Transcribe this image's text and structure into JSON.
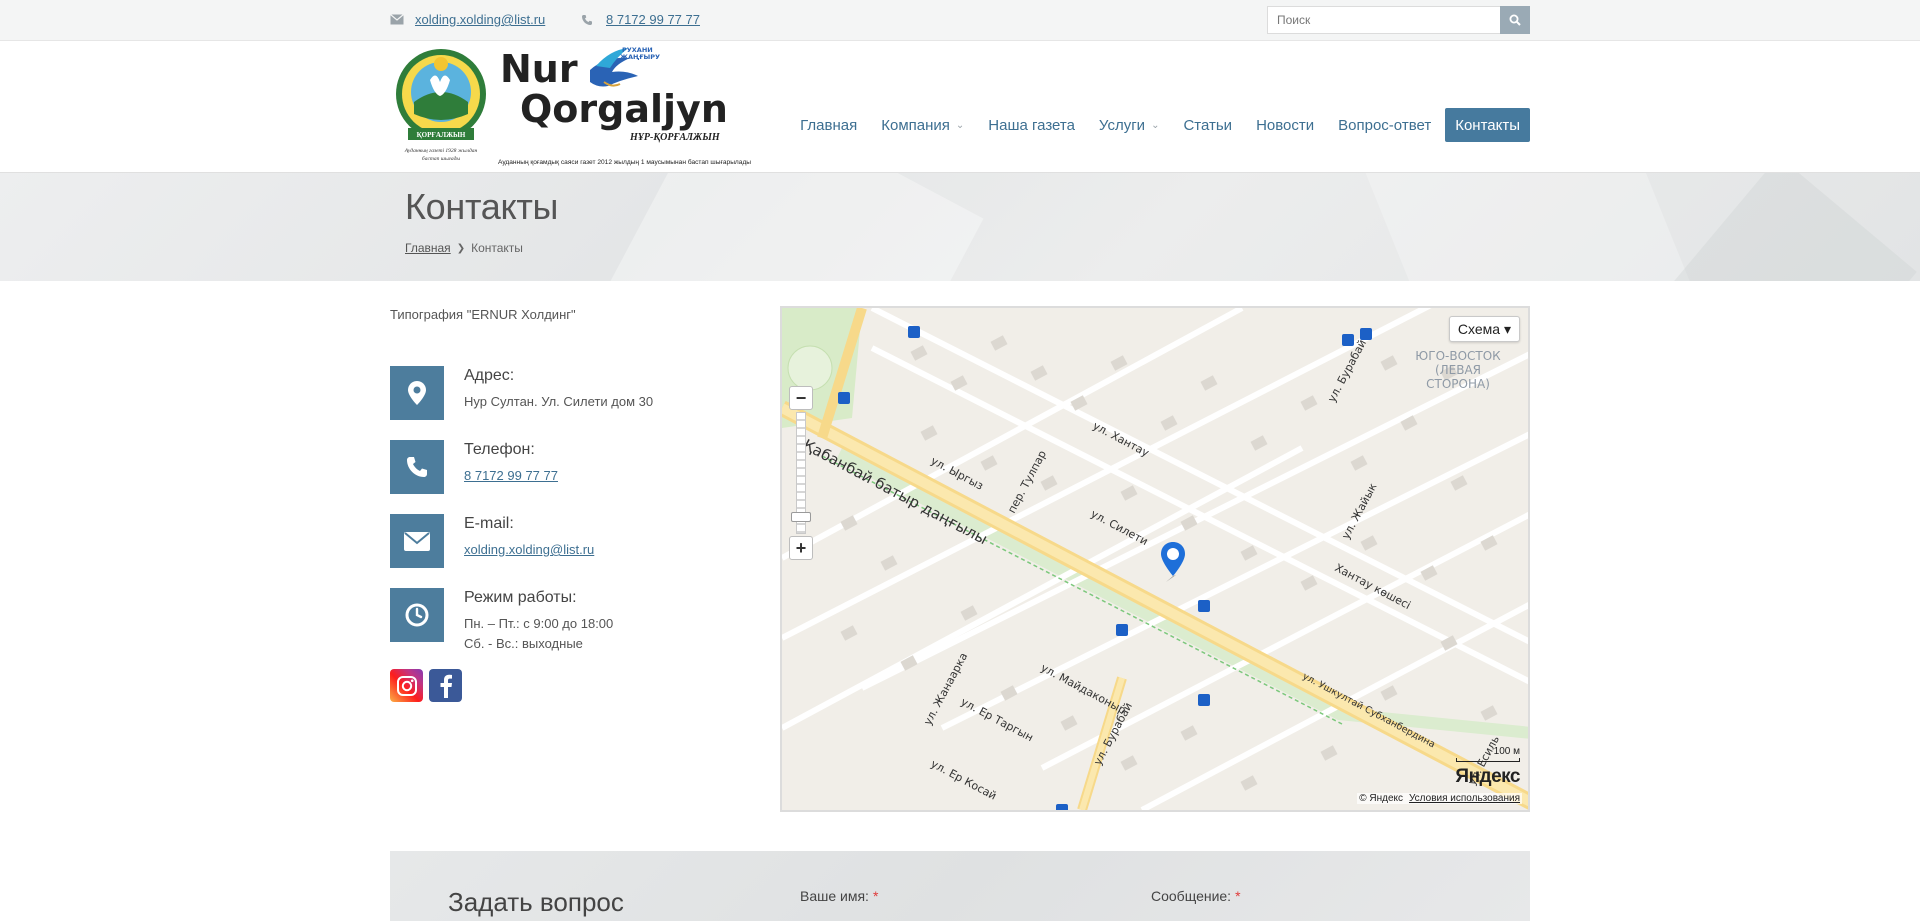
{
  "topbar": {
    "email": "xolding.xolding@list.ru",
    "phone": "8 7172 99 77 77",
    "search_placeholder": "Поиск"
  },
  "logo": {
    "text_line1": "Nur",
    "text_line2": "Qorgaljyn",
    "subtitle": "НҰР-ҚОРҒАЛЖЫН",
    "badge": "РУХАНИ ЖАҢҒЫРУ",
    "tagline": "Ауданның қоғамдық саяси газет 2012 жылдың 1 маусымынан бастап шығарылады"
  },
  "nav": {
    "items": [
      {
        "label": "Главная",
        "has_dropdown": false
      },
      {
        "label": "Компания",
        "has_dropdown": true
      },
      {
        "label": "Наша газета",
        "has_dropdown": false
      },
      {
        "label": "Услуги",
        "has_dropdown": true
      },
      {
        "label": "Статьи",
        "has_dropdown": false
      },
      {
        "label": "Новости",
        "has_dropdown": false
      },
      {
        "label": "Вопрос-ответ",
        "has_dropdown": false
      },
      {
        "label": "Контакты",
        "has_dropdown": false,
        "active": true
      }
    ]
  },
  "page": {
    "title": "Контакты",
    "breadcrumb": {
      "home": "Главная",
      "current": "Контакты"
    }
  },
  "contacts": {
    "company": "Типография \"ERNUR Холдинг\"",
    "address_label": "Адрес:",
    "address_value": "Нур Султан. Ул. Силети дом 30",
    "phone_label": "Телефон:",
    "phone_value": "8 7172 99 77 77",
    "email_label": "E-mail:",
    "email_value": "xolding.xolding@list.ru",
    "hours_label": "Режим работы:",
    "hours_weekdays": "Пн. – Пт.: с 9:00 до 18:00",
    "hours_weekend": "Сб. - Вс.: выходные"
  },
  "map": {
    "layer_button": "Схема ▾",
    "scale": "100 м",
    "brand": "Яндекс",
    "copyright": "© Яндекс",
    "terms": "Условия использования",
    "district": "ЮГО-ВОСТОК (ЛЕВАЯ СТОРОНА)",
    "streets": [
      "Қабанбай батыр даңғылы",
      "ул. Ыргыз",
      "пер. Тулпар",
      "ул. Силети",
      "ул. Хантау",
      "ул. Бурабай",
      "ул. Жайык",
      "Хантау көшесі",
      "ул. Майдаконыр",
      "ул. Жанаарка",
      "ул. Ер Таргын",
      "ул. Ер Косай",
      "ул. Ушкултай Субханбердина",
      "ул. Есиль"
    ]
  },
  "question_form": {
    "title": "Задать вопрос",
    "name_label": "Ваше имя:",
    "message_label": "Сообщение:",
    "required_mark": "*"
  },
  "colors": {
    "accent": "#467a9e",
    "link": "#3d6f91",
    "required": "#e03a3a"
  }
}
